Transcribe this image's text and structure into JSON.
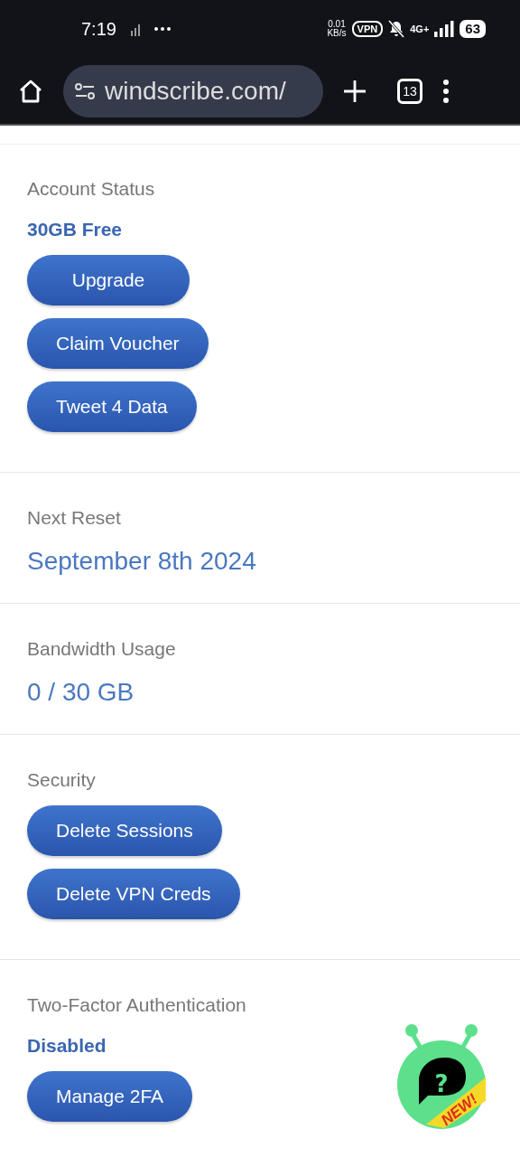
{
  "status_bar": {
    "time": "7:19",
    "network_speed": "0.01",
    "network_unit": "KB/s",
    "vpn": "VPN",
    "network_type": "4G+",
    "battery": "63"
  },
  "browser": {
    "url": "windscribe.com/",
    "tab_count": "13"
  },
  "sections": [
    {
      "label": "Account Status",
      "kind": "status",
      "value": "30GB Free",
      "buttons": [
        "Upgrade",
        "Claim Voucher",
        "Tweet 4 Data"
      ]
    },
    {
      "label": "Next Reset",
      "kind": "reading",
      "value": "September 8th 2024"
    },
    {
      "label": "Bandwidth Usage",
      "kind": "reading",
      "value": "0 / 30 GB"
    },
    {
      "label": "Security",
      "buttons": [
        "Delete Sessions",
        "Delete VPN Creds"
      ]
    },
    {
      "label": "Two-Factor Authentication",
      "kind": "status",
      "value": "Disabled",
      "buttons": [
        "Manage 2FA"
      ]
    }
  ],
  "help_widget": {
    "symbol": "?",
    "badge": "NEW!"
  }
}
